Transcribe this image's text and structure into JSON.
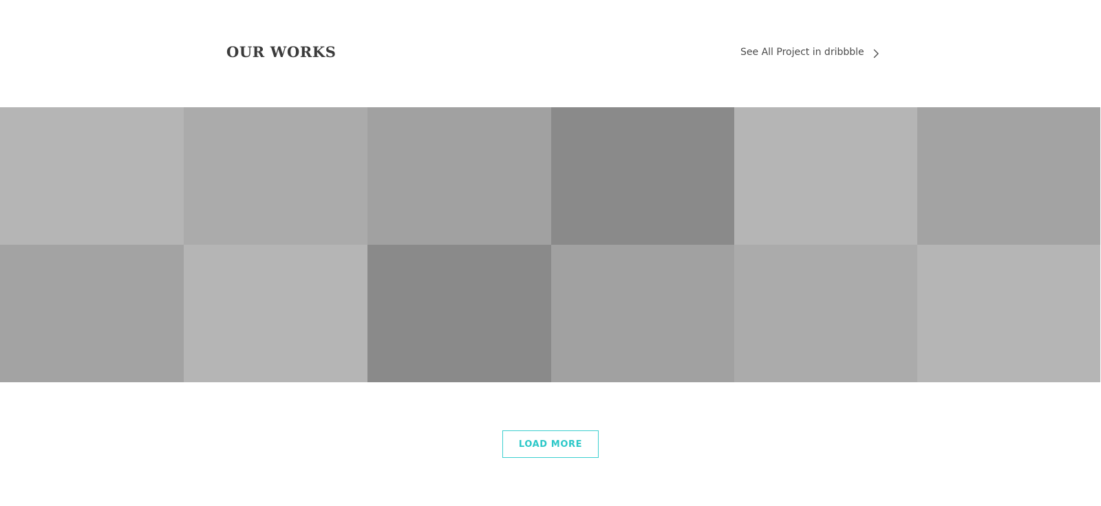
{
  "header": {
    "title": "OUR WORKS",
    "link_label": "See All Project in dribbble",
    "link_icon": "chevron-right-icon"
  },
  "gallery": {
    "tiles": [
      {
        "color": "#b5b5b5"
      },
      {
        "color": "#ababab"
      },
      {
        "color": "#a1a1a1"
      },
      {
        "color": "#8a8a8a"
      },
      {
        "color": "#b5b5b5"
      },
      {
        "color": "#a3a3a3"
      },
      {
        "color": "#a3a3a3"
      },
      {
        "color": "#b5b5b5"
      },
      {
        "color": "#8a8a8a"
      },
      {
        "color": "#a1a1a1"
      },
      {
        "color": "#ababab"
      },
      {
        "color": "#b5b5b5"
      }
    ]
  },
  "actions": {
    "load_more_label": "LOAD MORE"
  },
  "colors": {
    "accent": "#2cc8c8",
    "title_text": "#3b3b3b",
    "link_text": "#4a4a4a"
  }
}
